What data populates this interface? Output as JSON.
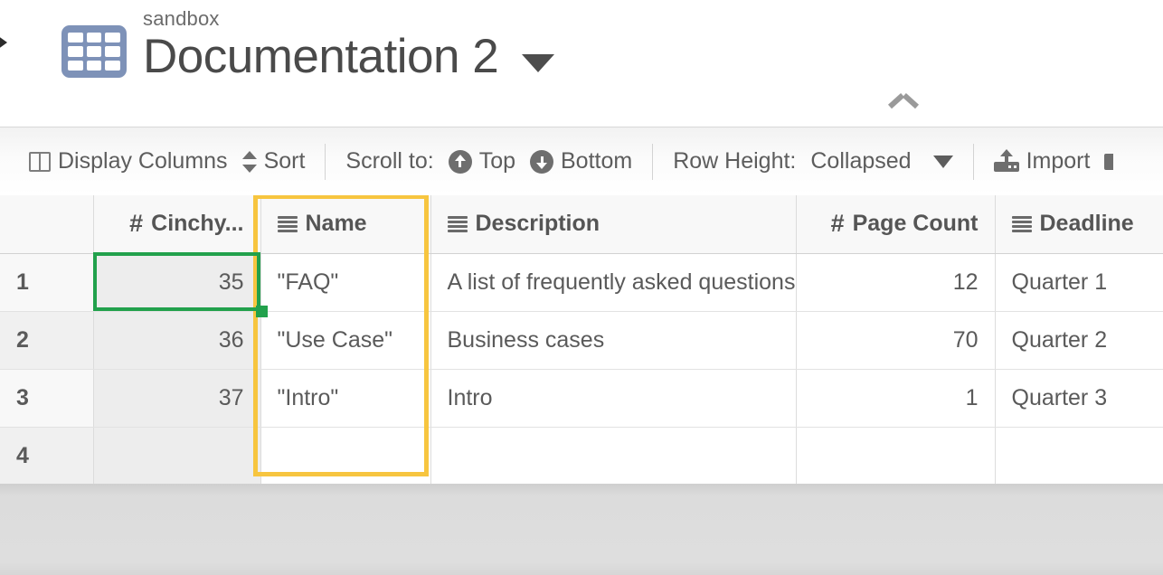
{
  "header": {
    "back_caret_icon": "caret-left-icon",
    "grid_icon": "table-grid-icon",
    "workspace": "sandbox",
    "title": "Documentation 2",
    "title_caret_icon": "caret-down-icon",
    "collapse_icon": "chevron-up-icon",
    "grid_icon_color": "#7e92b8"
  },
  "toolbar": {
    "display_columns_label": "Display Columns",
    "display_columns_icon": "columns-icon",
    "sort_label": "Sort",
    "sort_icon": "sort-updown-icon",
    "scroll_to_label": "Scroll to:",
    "scroll_top_label": "Top",
    "scroll_top_icon": "circle-arrow-up-icon",
    "scroll_bottom_label": "Bottom",
    "scroll_bottom_icon": "circle-arrow-down-icon",
    "row_height_label": "Row Height:",
    "row_height_value": "Collapsed",
    "row_height_caret_icon": "caret-down-icon",
    "import_label": "Import",
    "import_icon": "upload-icon",
    "export_icon": "download-icon"
  },
  "grid": {
    "columns": [
      {
        "key": "rownum",
        "label": "",
        "type_icon": "",
        "align": "left"
      },
      {
        "key": "id",
        "label": "Cinchy...",
        "type_icon": "number-icon",
        "align": "right"
      },
      {
        "key": "name",
        "label": "Name",
        "type_icon": "text-lines-icon",
        "align": "left"
      },
      {
        "key": "desc",
        "label": "Description",
        "type_icon": "text-lines-icon",
        "align": "left"
      },
      {
        "key": "pages",
        "label": "Page Count",
        "type_icon": "number-icon",
        "align": "right"
      },
      {
        "key": "dead",
        "label": "Deadline",
        "type_icon": "text-lines-icon",
        "align": "left"
      }
    ],
    "rows": [
      {
        "num": "1",
        "id": "35",
        "name": "\"FAQ\"",
        "desc": "A list of frequently asked questions",
        "pages": "12",
        "dead": "Quarter 1"
      },
      {
        "num": "2",
        "id": "36",
        "name": "\"Use Case\"",
        "desc": "Business cases",
        "pages": "70",
        "dead": "Quarter 2"
      },
      {
        "num": "3",
        "id": "37",
        "name": "\"Intro\"",
        "desc": "Intro",
        "pages": "1",
        "dead": "Quarter 3"
      },
      {
        "num": "4",
        "id": "",
        "name": "",
        "desc": "",
        "pages": "",
        "dead": ""
      }
    ],
    "selection": {
      "cell": "row1-id",
      "value": "35",
      "border_color": "#22a14c"
    },
    "column_highlight": {
      "column": "name",
      "border_color": "#f7c53f"
    }
  }
}
